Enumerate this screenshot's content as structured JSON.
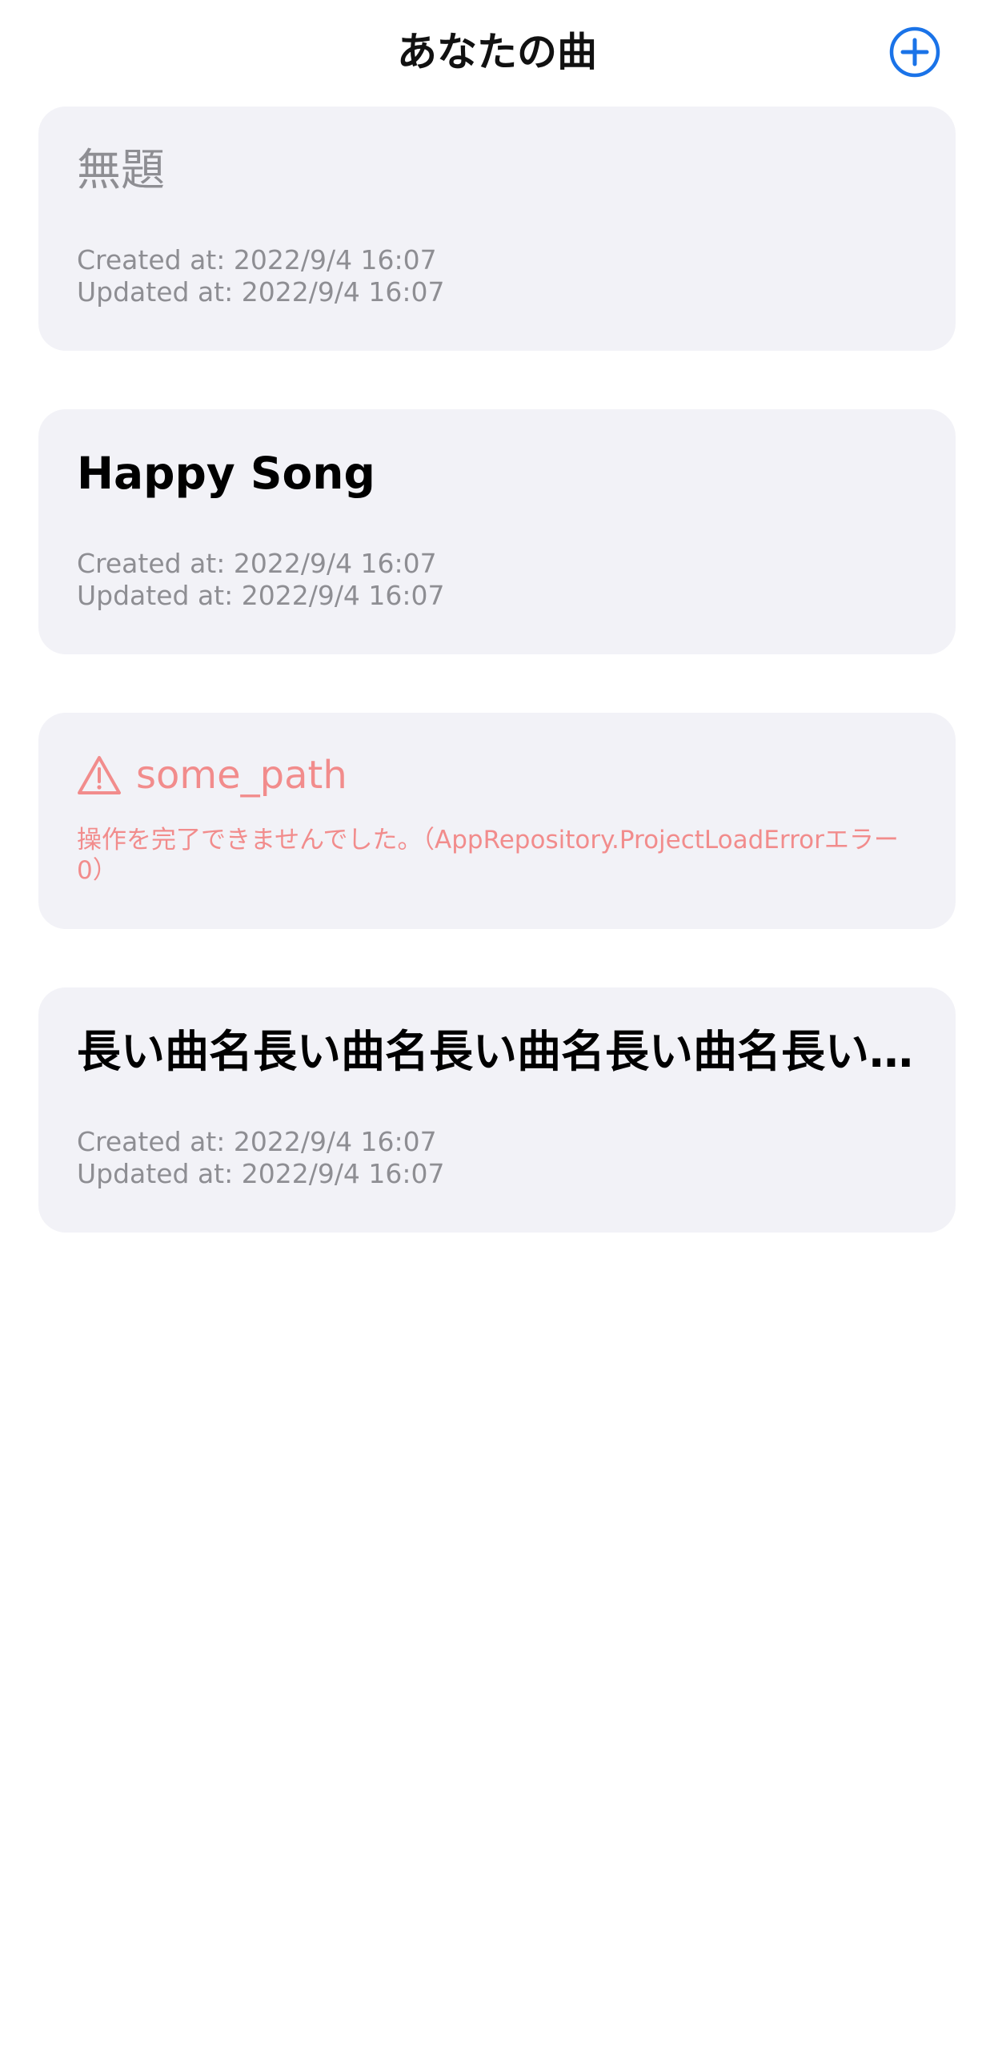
{
  "header": {
    "title": "あなたの曲",
    "add_icon": "plus-circle-icon",
    "accent_color": "#1a73e8"
  },
  "songs": [
    {
      "title": "無題",
      "created": "Created at: 2022/9/4 16:07",
      "updated": "Updated at: 2022/9/4 16:07"
    },
    {
      "title": "Happy Song",
      "created": "Created at: 2022/9/4 16:07",
      "updated": "Updated at: 2022/9/4 16:07"
    },
    {
      "error_icon": "warning-triangle-icon",
      "path": "some_path",
      "message": "操作を完了できませんでした。（AppRepository.ProjectLoadErrorエラー0）",
      "error_color": "#f28c8c"
    },
    {
      "title": "長い曲名長い曲名長い曲名長い曲名長い…",
      "created": "Created at: 2022/9/4 16:07",
      "updated": "Updated at: 2022/9/4 16:07"
    }
  ]
}
